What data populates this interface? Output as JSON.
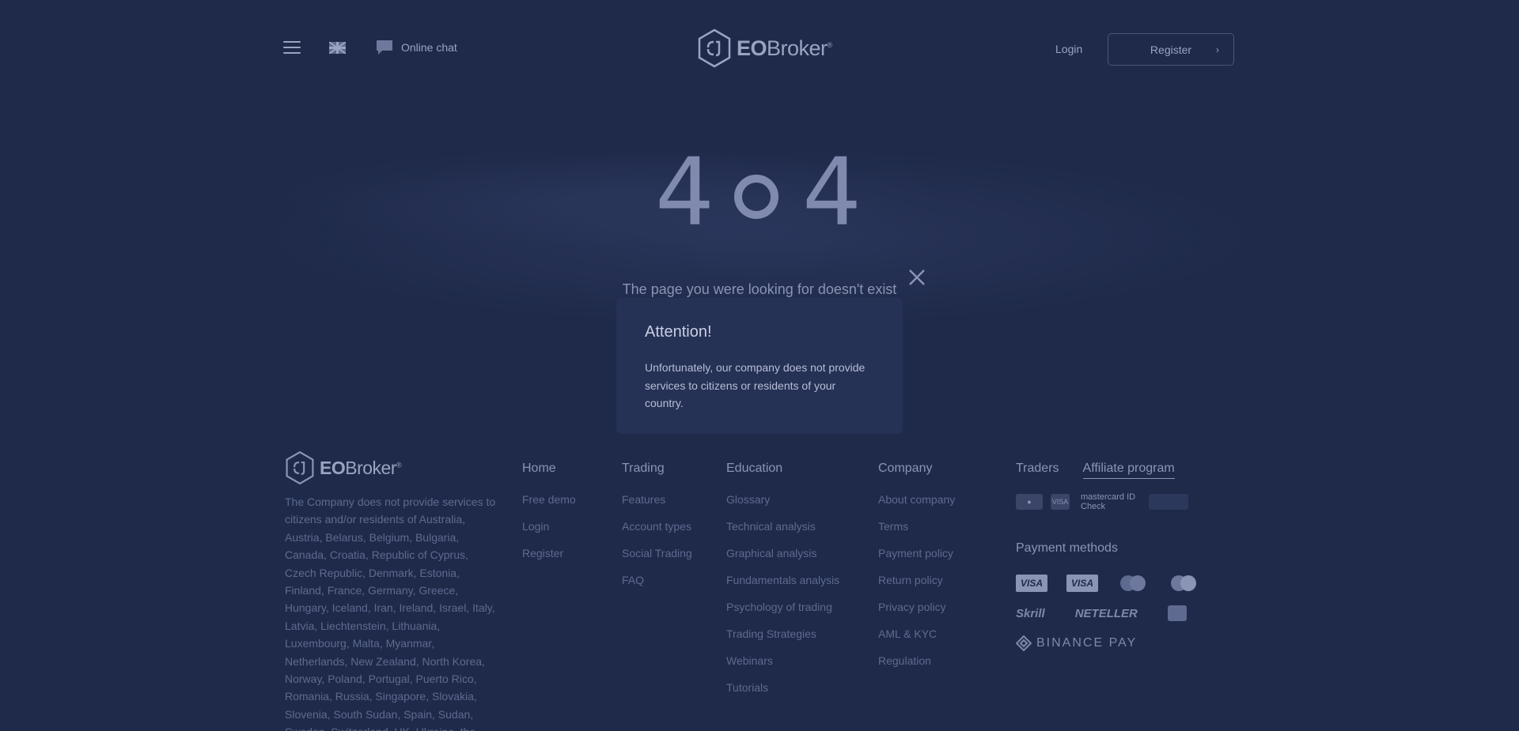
{
  "header": {
    "chat_label": "Online chat",
    "logo_text_bold": "EO",
    "logo_text_light": "Broker",
    "logo_reg": "®",
    "login_label": "Login",
    "register_label": "Register"
  },
  "error": {
    "code_left": "4",
    "code_right": "4",
    "message": "The page you were looking for doesn't exist"
  },
  "modal": {
    "title": "Attention!",
    "body": "Unfortunately, our company does not provide services to citizens or residents of your country."
  },
  "footer": {
    "description": "The Company does not provide services to citizens and/or residents of Australia, Austria, Belarus, Belgium, Bulgaria, Canada, Croatia, Republic of Cyprus, Czech Republic, Denmark, Estonia, Finland, France, Germany, Greece, Hungary, Iceland, Iran, Ireland, Israel, Italy, Latvia, Liechtenstein, Lithuania, Luxembourg, Malta, Myanmar, Netherlands, New Zealand, North Korea, Norway, Poland, Portugal, Puerto Rico, Romania, Russia, Singapore, Slovakia, Slovenia, South Sudan, Spain, Sudan, Sweden, Switzerland, UK, Ukraine, the",
    "home": {
      "title": "Home",
      "links": [
        "Free demo",
        "Login",
        "Register"
      ]
    },
    "trading": {
      "title": "Trading",
      "links": [
        "Features",
        "Account types",
        "Social Trading",
        "FAQ"
      ]
    },
    "education": {
      "title": "Education",
      "links": [
        "Glossary",
        "Technical analysis",
        "Graphical analysis",
        "Fundamentals analysis",
        "Psychology of trading",
        "Trading Strategies",
        "Webinars",
        "Tutorials"
      ]
    },
    "company": {
      "title": "Company",
      "links": [
        "About company",
        "Terms",
        "Payment policy",
        "Return policy",
        "Privacy policy",
        "AML & KYC",
        "Regulation"
      ]
    },
    "traders_tab": "Traders",
    "affiliate_tab": "Affiliate program",
    "badges": [
      "VISA",
      "mastercard ID Check"
    ],
    "payment_title": "Payment methods",
    "payments": {
      "visa": "VISA",
      "skrill": "Skrill",
      "neteller": "NETELLER",
      "binance": "BINANCE PAY"
    }
  },
  "colors": {
    "background": "#1f2a4a",
    "modal": "#253155",
    "muted_text": "#5e6a8f"
  }
}
